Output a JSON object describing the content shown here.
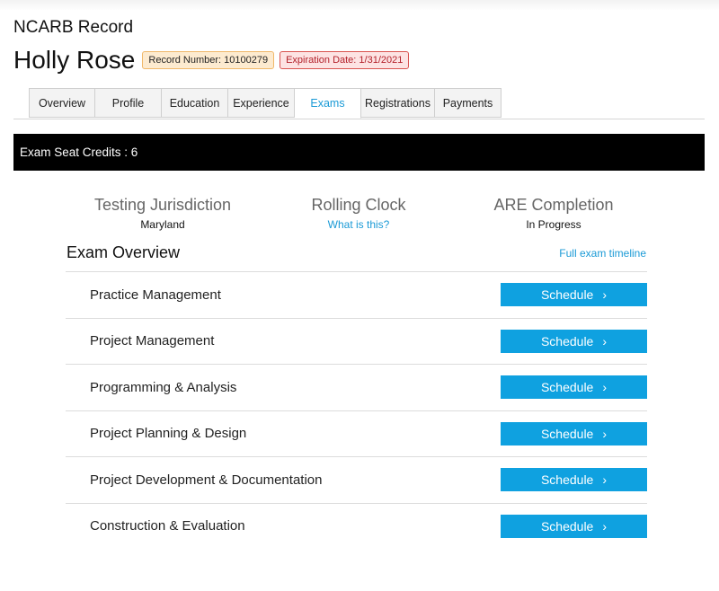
{
  "header": {
    "record_label": "NCARB Record",
    "person_name": "Holly Rose",
    "record_number": "Record Number: 10100279",
    "expiration_date": "Expiration Date: 1/31/2021"
  },
  "tabs": [
    {
      "label": "Overview",
      "active": false
    },
    {
      "label": "Profile",
      "active": false
    },
    {
      "label": "Education",
      "active": false
    },
    {
      "label": "Experience",
      "active": false
    },
    {
      "label": "Exams",
      "active": true
    },
    {
      "label": "Registrations",
      "active": false
    },
    {
      "label": "Payments",
      "active": false
    }
  ],
  "credits": {
    "text": "Exam Seat Credits : 6"
  },
  "stats": {
    "jurisdiction": {
      "title": "Testing Jurisdiction",
      "value": "Maryland"
    },
    "rolling_clock": {
      "title": "Rolling Clock",
      "link": "What is this?"
    },
    "completion": {
      "title": "ARE Completion",
      "value": "In Progress"
    }
  },
  "overview": {
    "title": "Exam Overview",
    "timeline_link": "Full exam timeline",
    "exams": [
      {
        "name": "Practice Management",
        "button": "Schedule",
        "chevron": "›"
      },
      {
        "name": "Project Management",
        "button": "Schedule",
        "chevron": "›"
      },
      {
        "name": "Programming & Analysis",
        "button": "Schedule",
        "chevron": "›"
      },
      {
        "name": "Project Planning & Design",
        "button": "Schedule",
        "chevron": "›"
      },
      {
        "name": "Project Development & Documentation",
        "button": "Schedule",
        "chevron": "›"
      },
      {
        "name": "Construction & Evaluation",
        "button": "Schedule",
        "chevron": "›"
      }
    ]
  },
  "colors": {
    "accent": "#1a9ad6",
    "button": "#0fa1e0",
    "credits_bar": "#000000",
    "record_badge": "#fdebd0",
    "expire_badge": "#fde3e3"
  }
}
